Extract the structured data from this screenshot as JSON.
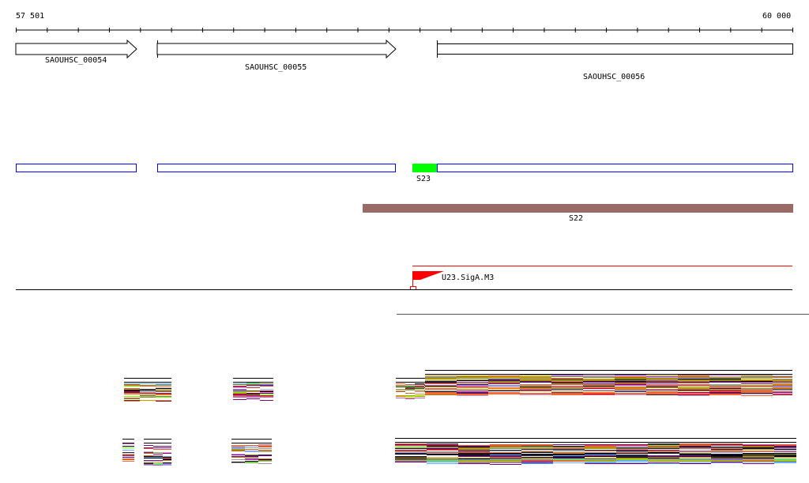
{
  "ruler": {
    "start_label": "57 501",
    "end_label": "60 000"
  },
  "genes": [
    {
      "name": "SAOUHSC_00054",
      "strand": "+"
    },
    {
      "name": "SAOUHSC_00055",
      "strand": "+"
    },
    {
      "name": "SAOUHSC_00056",
      "strand": "+"
    }
  ],
  "features": {
    "s23_label": "S23",
    "s22_label": "S22",
    "promoter_label": "U23.SigA.M3"
  },
  "colors": {
    "cds_box": "#0000ff",
    "s23": "#00ff00",
    "s22": "#9a6a66",
    "promoter": "#ff0000",
    "coverage_palette": [
      "#000000",
      "#8b8b1a",
      "#66ff00",
      "#d2691e",
      "#e0523a",
      "#c060c0",
      "#800080",
      "#66aaff",
      "#aaaaee",
      "#999999",
      "#ff6633",
      "#202040",
      "#b00050",
      "#cc9900"
    ]
  }
}
